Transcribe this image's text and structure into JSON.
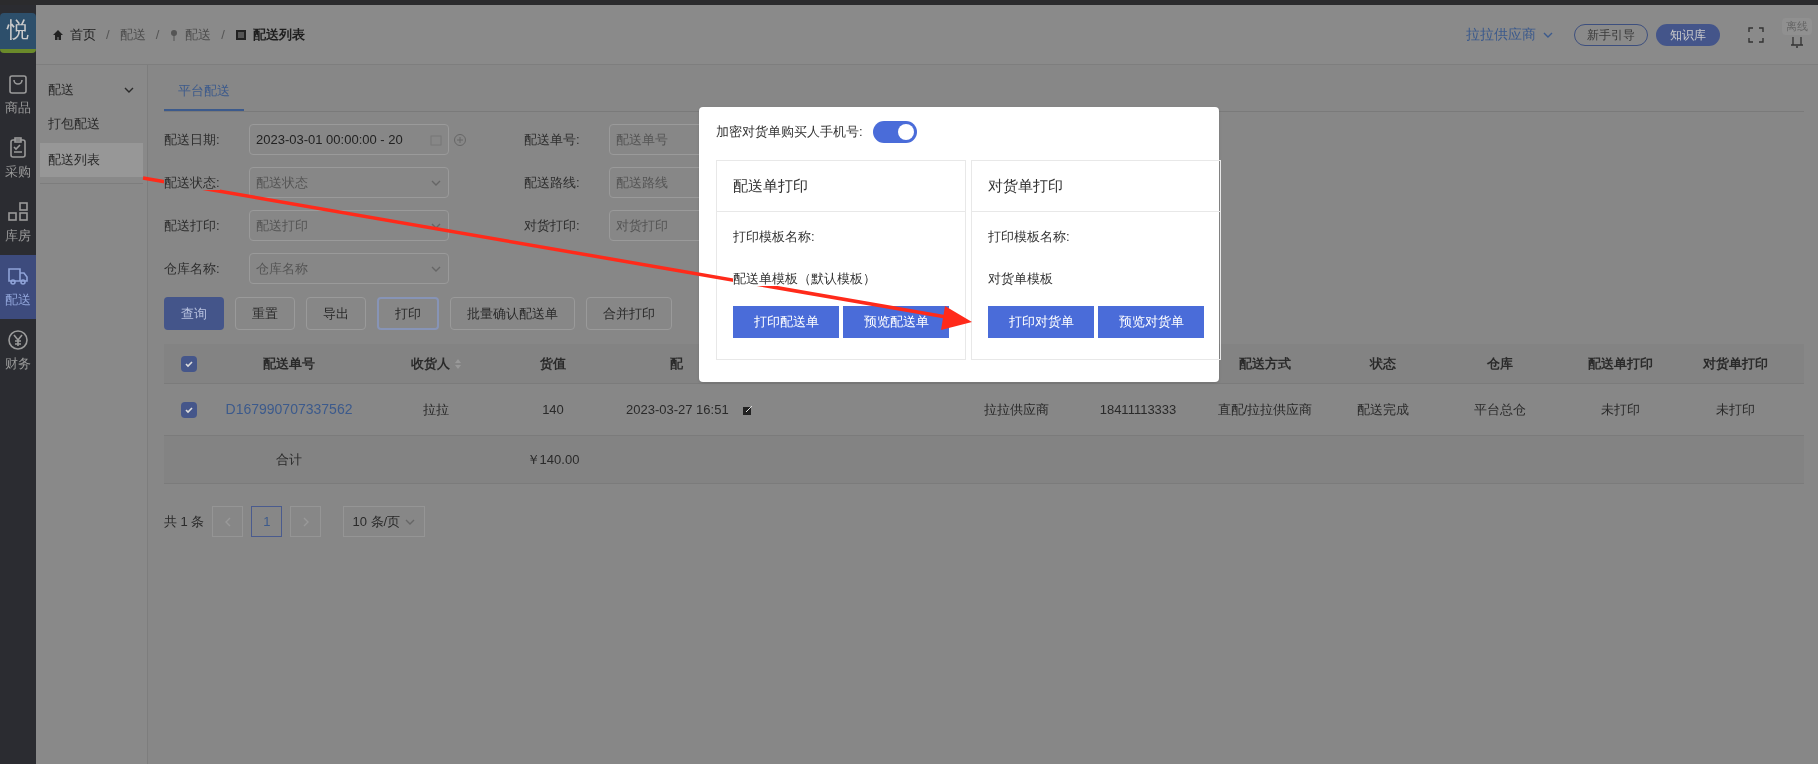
{
  "logo": {
    "text": "悦"
  },
  "rail": [
    {
      "label": "商品",
      "selected": false
    },
    {
      "label": "采购",
      "selected": false
    },
    {
      "label": "库房",
      "selected": false
    },
    {
      "label": "配送",
      "selected": true
    },
    {
      "label": "财务",
      "selected": false
    }
  ],
  "breadcrumb": {
    "separator": "/",
    "items": [
      "首页",
      "配送",
      "配送",
      "配送列表"
    ]
  },
  "header": {
    "supplier": "拉拉供应商",
    "guide": "新手引导",
    "knowledge": "知识库",
    "offline": "离线"
  },
  "submenu": {
    "group": "配送",
    "expanded": true,
    "items": [
      {
        "label": "打包配送",
        "selected": false
      },
      {
        "label": "配送列表",
        "selected": true
      }
    ]
  },
  "tabs": [
    {
      "label": "平台配送",
      "selected": true
    }
  ],
  "filters": [
    {
      "label": "配送日期:",
      "value": "2023-03-01 00:00:00 - 20",
      "kind": "date"
    },
    {
      "label": "配送单号:",
      "placeholder": "配送单号",
      "kind": "text"
    },
    {
      "label": "配送状态:",
      "placeholder": "配送状态",
      "kind": "select"
    },
    {
      "label": "配送路线:",
      "placeholder": "配送路线",
      "kind": "text"
    },
    {
      "label": "配送打印:",
      "placeholder": "配送打印",
      "kind": "select"
    },
    {
      "label": "对货打印:",
      "placeholder": "对货打印",
      "kind": "text"
    },
    {
      "label": "仓库名称:",
      "placeholder": "仓库名称",
      "kind": "select"
    }
  ],
  "actions": [
    {
      "label": "查询",
      "kind": "primary"
    },
    {
      "label": "重置",
      "kind": "default"
    },
    {
      "label": "导出",
      "kind": "default"
    },
    {
      "label": "打印",
      "kind": "focused"
    },
    {
      "label": "批量确认配送单",
      "kind": "default"
    },
    {
      "label": "合并打印",
      "kind": "default"
    }
  ],
  "table": {
    "all_checked": true,
    "columns": [
      {
        "label": "配送单号",
        "sortable": false
      },
      {
        "label": "收货人",
        "sortable": true
      },
      {
        "label": "货值",
        "sortable": false
      },
      {
        "label": "配",
        "sortable": false
      },
      {},
      {},
      {
        "label": "配送方式",
        "sortable": false
      },
      {
        "label": "状态",
        "sortable": false
      },
      {
        "label": "仓库",
        "sortable": false
      },
      {
        "label": "配送单打印",
        "sortable": false
      },
      {
        "label": "对货单打印",
        "sortable": false
      }
    ],
    "rows": [
      {
        "checked": true,
        "cells": [
          "D167990707337562",
          "拉拉",
          "140",
          "2023-03-27 16:51",
          "拉拉供应商",
          "18411113333",
          "直配/拉拉供应商",
          "配送完成",
          "平台总仓",
          "未打印",
          "未打印"
        ]
      }
    ],
    "total": {
      "label": "合计",
      "value": "￥140.00"
    }
  },
  "pagination": {
    "total": "共 1 条",
    "pages": [
      {
        "label": "1",
        "selected": true
      }
    ],
    "page_size": "10 条/页"
  },
  "modal": {
    "toggle_label": "加密对货单购买人手机号:",
    "toggle_on": true,
    "cards": [
      {
        "title": "配送单打印",
        "field_label": "打印模板名称:",
        "template": "配送单模板（默认模板）",
        "buttons": [
          "打印配送单",
          "预览配送单"
        ]
      },
      {
        "title": "对货单打印",
        "field_label": "打印模板名称:",
        "template": "对货单模板",
        "buttons": [
          "打印对货单",
          "预览对货单"
        ]
      }
    ]
  }
}
